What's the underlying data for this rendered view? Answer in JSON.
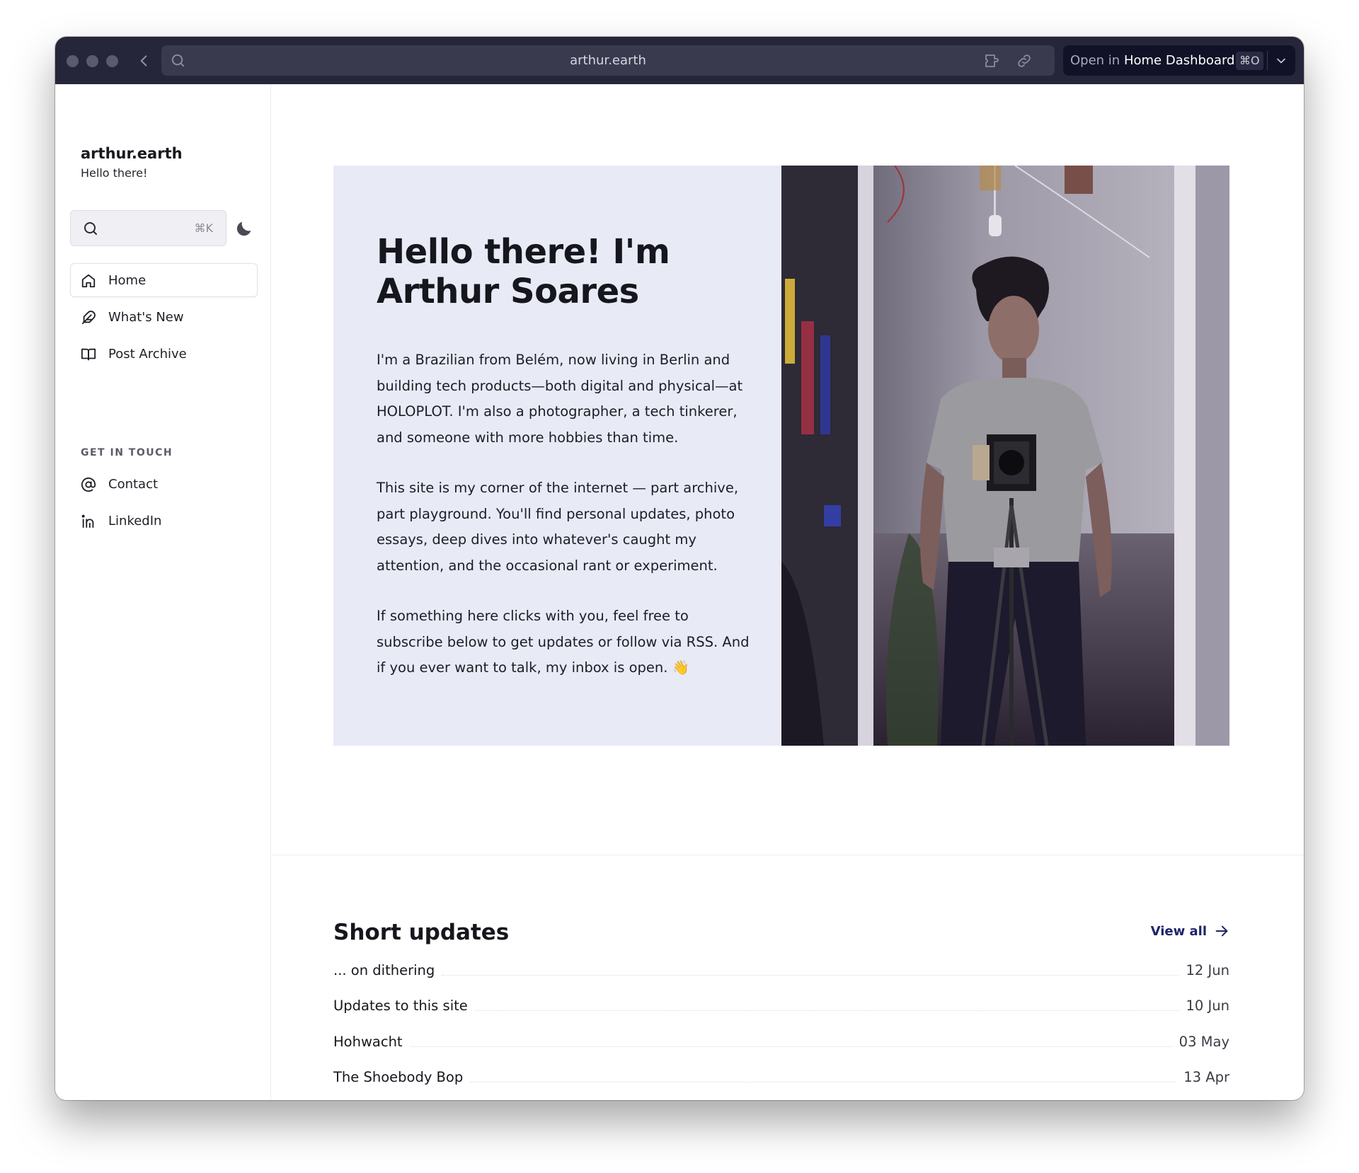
{
  "browser": {
    "url": "arthur.earth",
    "open_in_prefix": "Open in",
    "open_in_target": "Home Dashboard",
    "open_in_shortcut": "⌘O"
  },
  "sidebar": {
    "site_title": "arthur.earth",
    "site_subtitle": "Hello there!",
    "search_shortcut": "⌘K",
    "nav": [
      {
        "label": "Home",
        "icon": "home-icon",
        "active": true
      },
      {
        "label": "What's New",
        "icon": "feather-icon",
        "active": false
      },
      {
        "label": "Post Archive",
        "icon": "book-open-icon",
        "active": false
      }
    ],
    "section_label": "GET IN TOUCH",
    "contact": [
      {
        "label": "Contact",
        "icon": "at-sign-icon"
      },
      {
        "label": "LinkedIn",
        "icon": "linkedin-icon"
      }
    ]
  },
  "hero": {
    "title": "Hello there! I'm Arthur Soares",
    "paragraphs": [
      "I'm a Brazilian from Belém, now living in Berlin and building tech products—both digital and physical—at HOLOPLOT. I'm also a photographer, a tech tinkerer, and someone with more hobbies than time.",
      "This site is my corner of the internet — part archive, part playground. You'll find personal updates, photo essays, deep dives into whatever's caught my attention, and the occasional rant or experiment.",
      "If something here clicks with you, feel free to subscribe below to get updates or follow via RSS. And if you ever want to talk, my inbox is open. 👋"
    ]
  },
  "updates": {
    "title": "Short updates",
    "view_all": "View all",
    "items": [
      {
        "title": "... on dithering",
        "date": "12 Jun"
      },
      {
        "title": "Updates to this site",
        "date": "10 Jun"
      },
      {
        "title": "Hohwacht",
        "date": "03 May"
      },
      {
        "title": "The Shoebody Bop",
        "date": "13 Apr"
      }
    ]
  },
  "colors": {
    "titlebar": "#26263a",
    "hero_bg": "#e8eaf6",
    "accent": "#1f236a"
  }
}
